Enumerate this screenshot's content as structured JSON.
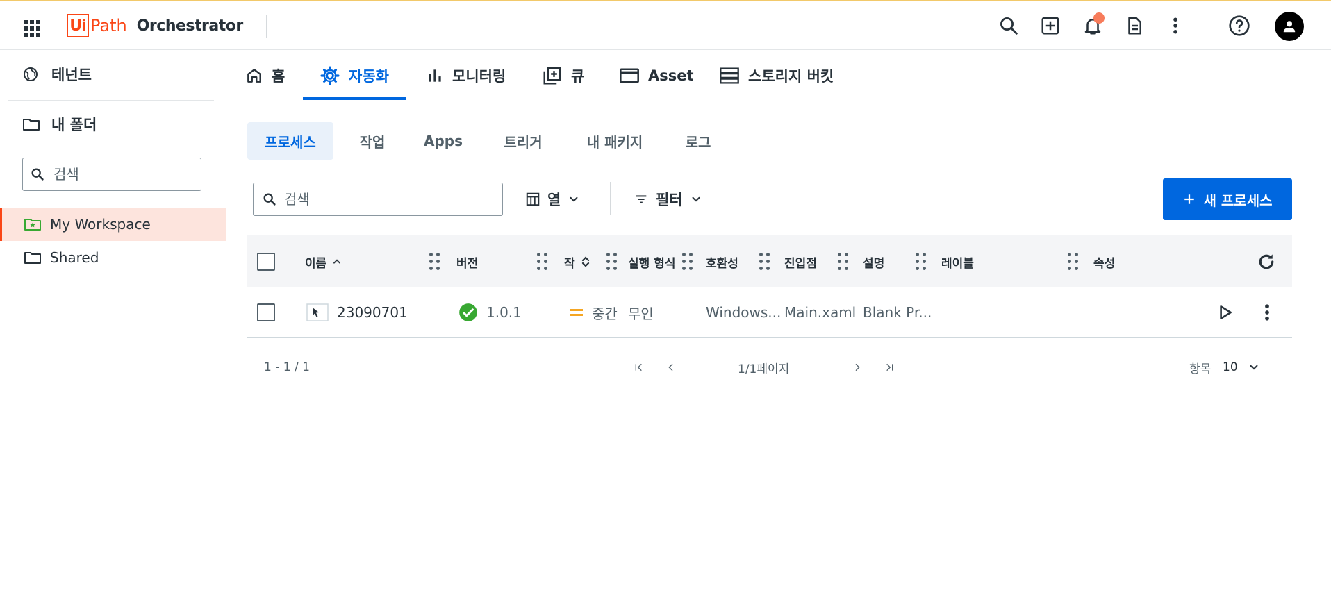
{
  "header": {
    "logo_box": "Ui",
    "logo_path": "Path",
    "product": "Orchestrator"
  },
  "sidebar": {
    "tenant": "테넌트",
    "my_folder": "내 폴더",
    "search_placeholder": "검색",
    "folders": [
      {
        "label": "My Workspace",
        "active": true
      },
      {
        "label": "Shared",
        "active": false
      }
    ]
  },
  "tabs": [
    {
      "label": "홈",
      "icon": "home-icon"
    },
    {
      "label": "자동화",
      "icon": "automation-gear-icon",
      "active": true
    },
    {
      "label": "모니터링",
      "icon": "bar-chart-icon"
    },
    {
      "label": "큐",
      "icon": "queue-add-icon"
    },
    {
      "label": "Asset",
      "icon": "window-icon"
    },
    {
      "label": "스토리지 버킷",
      "icon": "storage-icon"
    }
  ],
  "subtabs": [
    {
      "label": "프로세스",
      "active": true
    },
    {
      "label": "작업"
    },
    {
      "label": "Apps"
    },
    {
      "label": "트리거"
    },
    {
      "label": "내 패키지"
    },
    {
      "label": "로그"
    }
  ],
  "toolbar": {
    "search_placeholder": "검색",
    "columns_label": "열",
    "filter_label": "필터",
    "new_process_label": "새 프로세스"
  },
  "table": {
    "columns": [
      "이름",
      "버전",
      "작",
      "실행 형식",
      "호환성",
      "진입점",
      "설명",
      "레이블",
      "속성"
    ],
    "rows": [
      {
        "name": "23090701",
        "version": "1.0.1",
        "priority": "중간",
        "execution_type": "무인",
        "compatibility": "Windows...",
        "entry_point": "Main.xaml",
        "description": "Blank Pr..."
      }
    ]
  },
  "pagination": {
    "range": "1 - 1 / 1",
    "page_info": "1/1페이지",
    "items_label": "항목",
    "page_size": "10"
  },
  "colors": {
    "brand_orange": "#fa4616",
    "primary_blue": "#0067df",
    "success_green": "#38a832",
    "priority_amber": "#f5a623"
  }
}
